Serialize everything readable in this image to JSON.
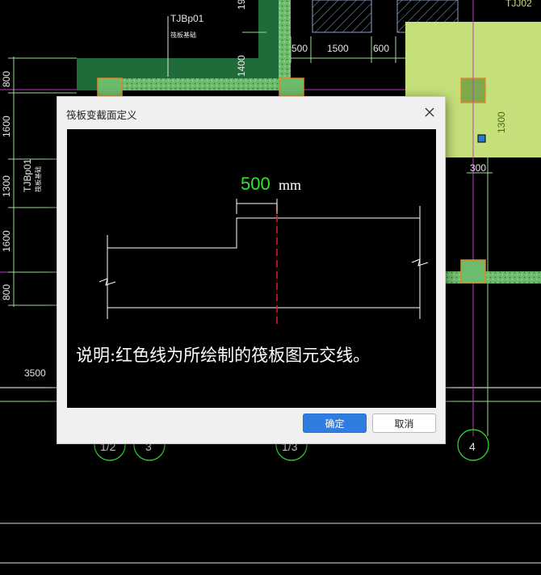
{
  "background": {
    "labels": {
      "tjbp_top": "TJBp01",
      "tjbp_top_sub": "筏板基础",
      "tjbp_left": "TJBp01",
      "tjbp_left_sub": "筏板基础",
      "tjbp_right": "TJJ02",
      "dim_19": "19",
      "dim_500": "500",
      "dim_1500a": "1500",
      "dim_600": "600",
      "dim_1500b": "1500",
      "dim_1400": "1400",
      "dim_1300_right": "1300",
      "dim_300": "300",
      "dim_800_top": "800",
      "dim_1600a": "1600",
      "dim_1300_left": "1300",
      "dim_1600b": "1600",
      "dim_800_bottom": "800",
      "dim_3500": "3500",
      "axis_1_2": "1/2",
      "axis_3": "3",
      "axis_1_3": "1/3",
      "axis_4": "4"
    }
  },
  "dialog": {
    "title": "筏板变截面定义",
    "preview": {
      "dim_value": "500",
      "dim_unit": "mm",
      "description": "说明:红色线为所绘制的筏板图元交线。"
    },
    "ok_label": "确定",
    "cancel_label": "取消"
  },
  "colors": {
    "dim_green": "#2ee62e",
    "intersect_red": "#e02020",
    "accent_blue": "#2f7de1",
    "slab_green": "#1f6b3a",
    "panel_lime": "#c5e07a"
  }
}
